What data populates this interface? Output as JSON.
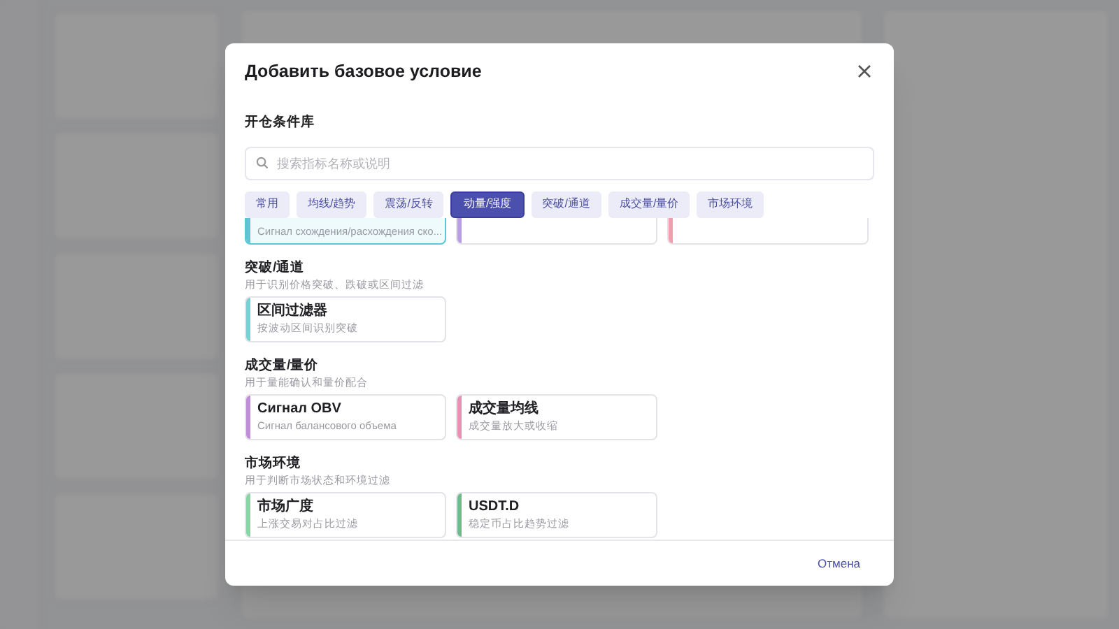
{
  "dialog": {
    "title": "Добавить базовое условие",
    "library_title": "开仓条件库",
    "search": {
      "placeholder": "搜索指标名称或说明"
    },
    "tabs": [
      {
        "label": "常用",
        "selected": false
      },
      {
        "label": "均线/趋势",
        "selected": false
      },
      {
        "label": "震荡/反转",
        "selected": false
      },
      {
        "label": "动量/强度",
        "selected": true
      },
      {
        "label": "突破/通道",
        "selected": false
      },
      {
        "label": "成交量/量价",
        "selected": false
      },
      {
        "label": "市场环境",
        "selected": false
      }
    ],
    "partial_cards": [
      {
        "description": "Сигнал схождения/расхождения ско...",
        "color": "#5cc6d4",
        "selected": true
      },
      {
        "color": "#b89ee0",
        "selected": false
      },
      {
        "color": "#ee9fb0",
        "selected": false
      }
    ],
    "sections": [
      {
        "title": "突破/通道",
        "subtitle": "用于识别价格突破、跌破或区间过滤",
        "cards": [
          {
            "title": "区间过滤器",
            "description": "按波动区间识别突破",
            "color": "#7ccfd2"
          }
        ]
      },
      {
        "title": "成交量/量价",
        "subtitle": "用于量能确认和量价配合",
        "cards": [
          {
            "title": "Сигнал OBV",
            "description": "Сигнал балансового объема",
            "color": "#c08ed8"
          },
          {
            "title": "成交量均线",
            "description": "成交量放大或收缩",
            "color": "#e98fb4"
          }
        ]
      },
      {
        "title": "市场环境",
        "subtitle": "用于判断市场状态和环境过滤",
        "cards": [
          {
            "title": "市场广度",
            "description": "上涨交易对占比过滤",
            "color": "#8dd3a8"
          },
          {
            "title": "USDT.D",
            "description": "稳定币占比趋势过滤",
            "color": "#6dbd8c"
          }
        ]
      }
    ],
    "cancel_button": "Отмена"
  }
}
